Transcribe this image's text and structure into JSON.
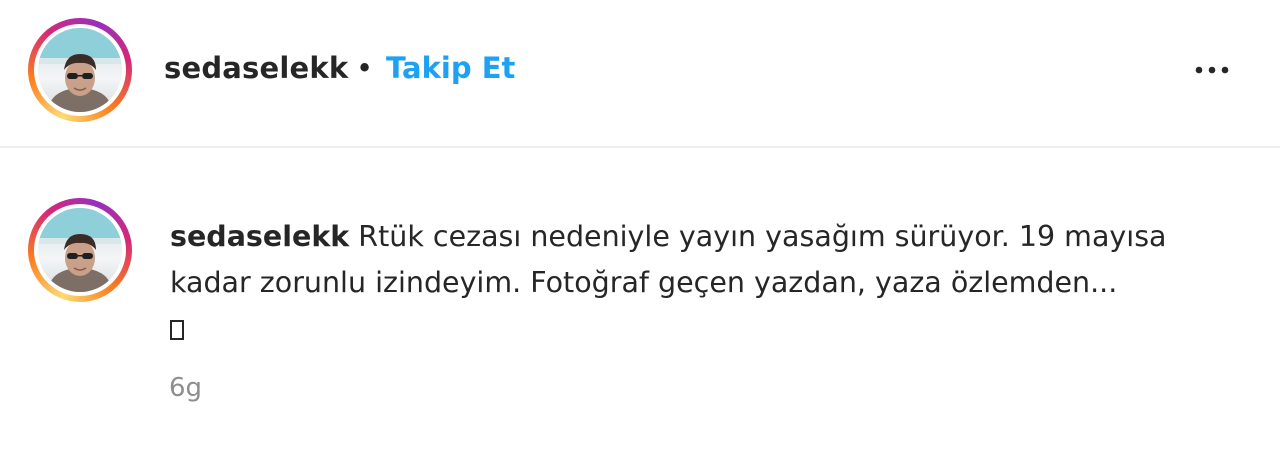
{
  "header": {
    "username": "sedaselekk",
    "separator": "•",
    "follow_label": "Takip Et",
    "more_icon": "more-horizontal-icon"
  },
  "caption": {
    "username": "sedaselekk",
    "line1": "Rtük cezası nedeniyle yayın yasağım sürüyor. 19 mayısa",
    "line2": "kadar zorunlu izindeyim. Fotoğraf geçen yazdan, yaza özlemden...",
    "emoji_icon": "missing-glyph-icon"
  },
  "timestamp": "6g",
  "colors": {
    "follow_blue": "#1da1f2",
    "text": "#262626",
    "muted": "#8e8e8e",
    "divider": "#efefef"
  }
}
